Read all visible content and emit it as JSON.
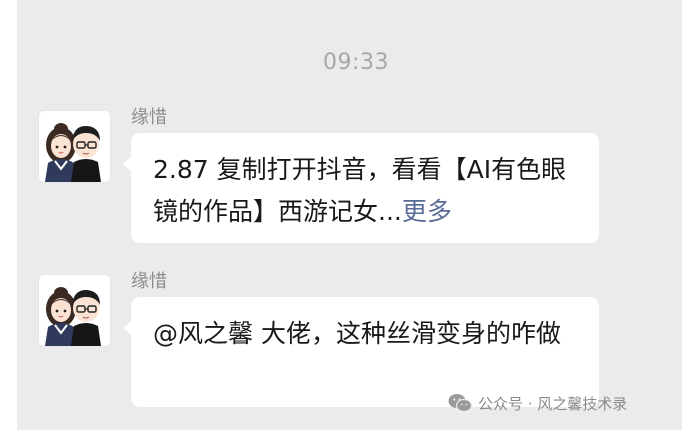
{
  "timestamp": "09:33",
  "messages": [
    {
      "sender": "缘惜",
      "text": "2.87 复制打开抖音，看看【AI有色眼镜的作品】西游记女...",
      "more_label": "更多"
    },
    {
      "sender": "缘惜",
      "text": "@风之馨 大佬，这种丝滑变身的咋做"
    }
  ],
  "watermark": {
    "icon": "wechat-icon",
    "text": "公众号 · 风之馨技术录"
  },
  "colors": {
    "background": "#ebebeb",
    "bubble": "#ffffff",
    "link": "#576b95",
    "timestamp": "#a7a7a7"
  }
}
